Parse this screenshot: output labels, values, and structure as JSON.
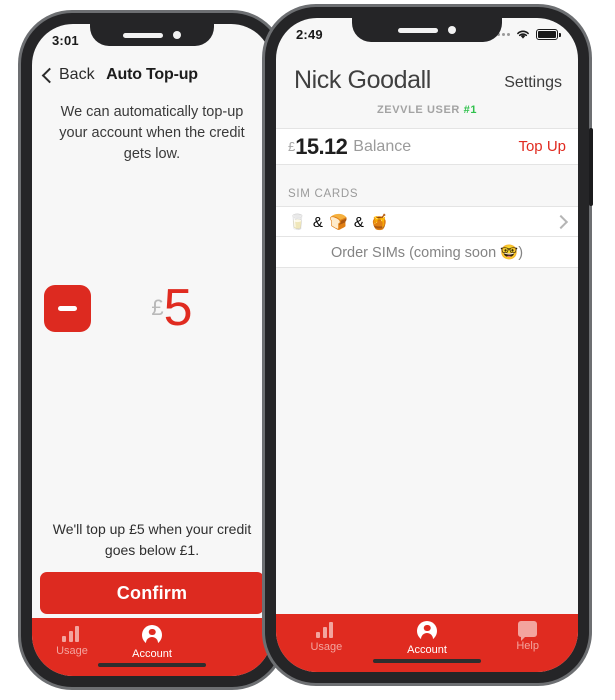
{
  "left_phone": {
    "status_bar": {
      "time": "3:01"
    },
    "nav": {
      "back_label": "Back",
      "title": "Auto Top-up"
    },
    "blurb": "We can automatically top-up your account when the credit gets low.",
    "stepper": {
      "decrease_icon": "minus-icon"
    },
    "amount": {
      "currency": "£",
      "value": "5"
    },
    "footnote": "We'll top up £5 when your credit goes below £1.",
    "confirm_label": "Confirm",
    "tabs": [
      {
        "label": "Usage",
        "icon": "bar-chart-icon",
        "active": false
      },
      {
        "label": "Account",
        "icon": "person-icon",
        "active": true
      }
    ]
  },
  "right_phone": {
    "status_bar": {
      "time": "2:49"
    },
    "header": {
      "name": "Nick Goodall",
      "settings_label": "Settings"
    },
    "user_line": {
      "prefix": "ZEVVLE USER",
      "number": "#1",
      "number_color": "#2fc14c"
    },
    "balance": {
      "currency": "£",
      "value": "15.12",
      "label": "Balance",
      "action_label": "Top Up"
    },
    "sim_section": {
      "header": "SIM CARDS"
    },
    "sim_row": {
      "emoji_text": "🥛 & 🍞 & 🍯"
    },
    "order_row": {
      "label": "Order SIMs (coming soon 🤓)"
    },
    "tabs": [
      {
        "label": "Usage",
        "icon": "bar-chart-icon",
        "active": false
      },
      {
        "label": "Account",
        "icon": "person-icon",
        "active": true
      },
      {
        "label": "Help",
        "icon": "chat-bubble-icon",
        "active": false
      }
    ]
  },
  "theme": {
    "brand_red": "#e02b20",
    "accent_green": "#2fc14c",
    "frame_gray": "#6d6f72",
    "bezel_black": "#252527"
  }
}
